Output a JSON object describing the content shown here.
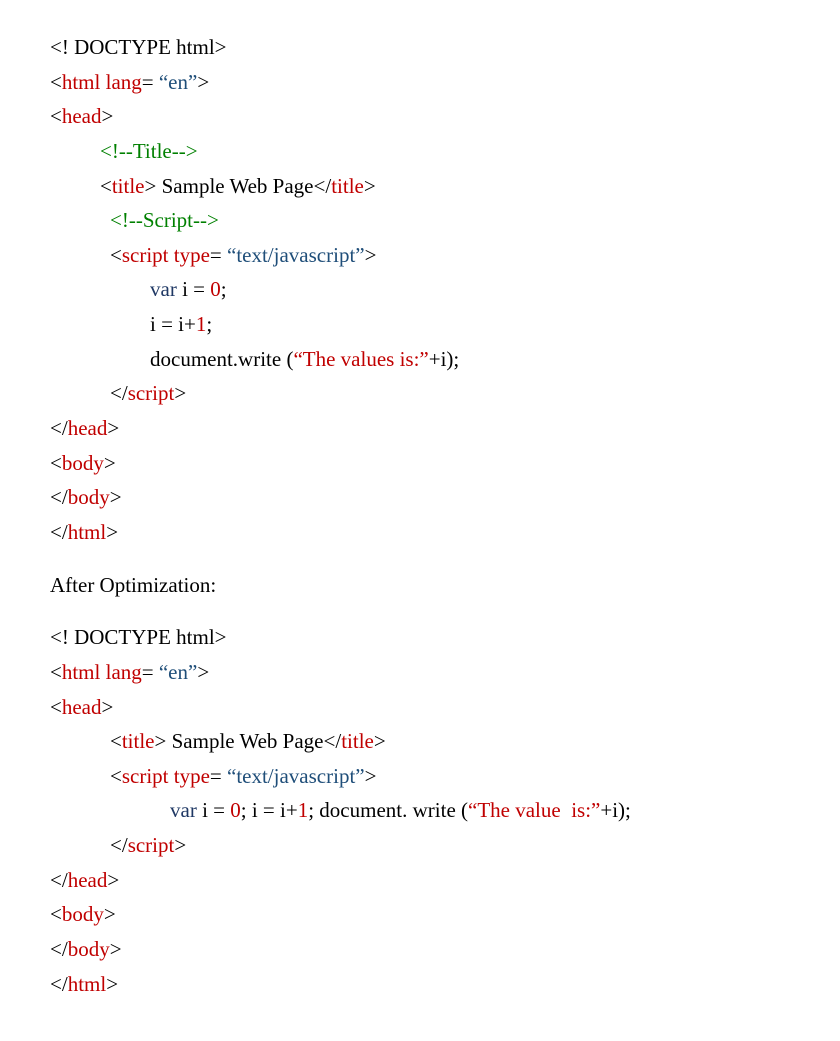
{
  "block1": {
    "l1": {
      "a": "<! DOCTYPE html>"
    },
    "l2": {
      "a": "<",
      "b": "html",
      "c": " ",
      "d": "lang",
      "e": "= ",
      "f": "“en”",
      "g": ">"
    },
    "l3": {
      "a": "<",
      "b": "head",
      "c": ">"
    },
    "l4": {
      "a": "<!--Title-->"
    },
    "l5": {
      "a": "<",
      "b": "title",
      "c": "> Sample Web Page</",
      "d": "title",
      "e": ">"
    },
    "l6": {
      "a": "<!--Script-->"
    },
    "l7": {
      "a": "<",
      "b": "script",
      "c": " ",
      "d": "type",
      "e": "= ",
      "f": "“text/javascript”",
      "g": ">"
    },
    "l8": {
      "a": "var",
      "b": " i = ",
      "c": "0",
      "d": ";"
    },
    "l9": {
      "a": "i = i+",
      "b": "1",
      "c": ";"
    },
    "l10": {
      "a": "document.write (",
      "b": "“The values is:”",
      "c": "+i);"
    },
    "l11": {
      "a": "</",
      "b": "script",
      "c": ">"
    },
    "l12": {
      "a": "</",
      "b": "head",
      "c": ">"
    },
    "l13": {
      "a": "<",
      "b": "body",
      "c": ">"
    },
    "l14": {
      "a": "</",
      "b": "body",
      "c": ">"
    },
    "l15": {
      "a": "</",
      "b": "html",
      "c": ">"
    }
  },
  "label": "After Optimization:",
  "block2": {
    "l1": {
      "a": "<! DOCTYPE html>"
    },
    "l2": {
      "a": "<",
      "b": "html",
      "c": " ",
      "d": "lang",
      "e": "= ",
      "f": "“en”",
      "g": ">"
    },
    "l3": {
      "a": "<",
      "b": "head",
      "c": ">"
    },
    "l4": {
      "a": "<",
      "b": "title",
      "c": "> Sample Web Page</",
      "d": "title",
      "e": ">"
    },
    "l5": {
      "a": "<",
      "b": "script",
      "c": " ",
      "d": "type",
      "e": "= ",
      "f": "“text/javascript”",
      "g": ">"
    },
    "l6": {
      "a": "var",
      "b": " i = ",
      "c": "0",
      "d": "; i = i+",
      "e": "1",
      "f": "; document. write (",
      "g": "“The value  is:”",
      "h": "+i);"
    },
    "l7": {
      "a": "</",
      "b": "script",
      "c": ">"
    },
    "l8": {
      "a": "</",
      "b": "head",
      "c": ">"
    },
    "l9": {
      "a": "<",
      "b": "body",
      "c": ">"
    },
    "l10": {
      "a": "</",
      "b": "body",
      "c": ">"
    },
    "l11": {
      "a": "</",
      "b": "html",
      "c": ">"
    }
  }
}
